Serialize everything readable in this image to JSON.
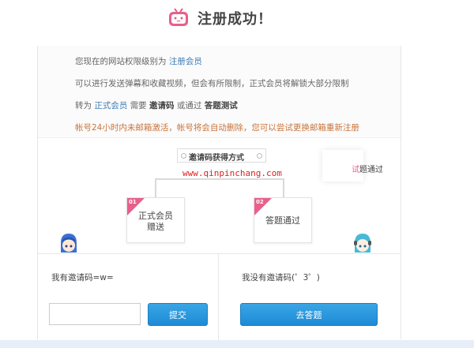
{
  "header": {
    "title": "注册成功！",
    "logo_icon": "tv-mascot-icon",
    "logo_color": "#e8608a"
  },
  "info": {
    "line1_prefix": "您现在的网站权限级别为",
    "line1_highlight": "注册会员",
    "line2": "可以进行发送弹幕和收藏视频，但会有所限制，正式会员将解锁大部分限制",
    "line3_prefix": "转为",
    "line3_highlight": "正式会员",
    "line3_mid1": "需要",
    "line3_bold1": "邀请码",
    "line3_mid2": "或通过",
    "line3_bold2": "答题测试",
    "line4_warning": "帐号24小时内未邮箱激活，帐号将会自动删除，您可以尝试更换邮箱重新注册"
  },
  "flow": {
    "title": "邀请码获得方式",
    "watermark": "www.qinpinchang.com",
    "right_note_pink": "试",
    "right_note": "题通过",
    "nodes": [
      {
        "num": "01",
        "label_line1": "正式会员",
        "label_line2": "赠送"
      },
      {
        "num": "02",
        "label_line1": "答题通过",
        "label_line2": ""
      }
    ]
  },
  "bottom": {
    "left_title": "我有邀请码=w=",
    "invite_input_value": "",
    "submit_label": "提交",
    "right_title": "我没有邀请码(゜3゜)",
    "quiz_label": "去答题"
  },
  "colors": {
    "accent_blue": "#1d8ad5",
    "link_blue": "#3d7bb6",
    "warning_orange": "#c8743c",
    "pink": "#e8608a"
  }
}
